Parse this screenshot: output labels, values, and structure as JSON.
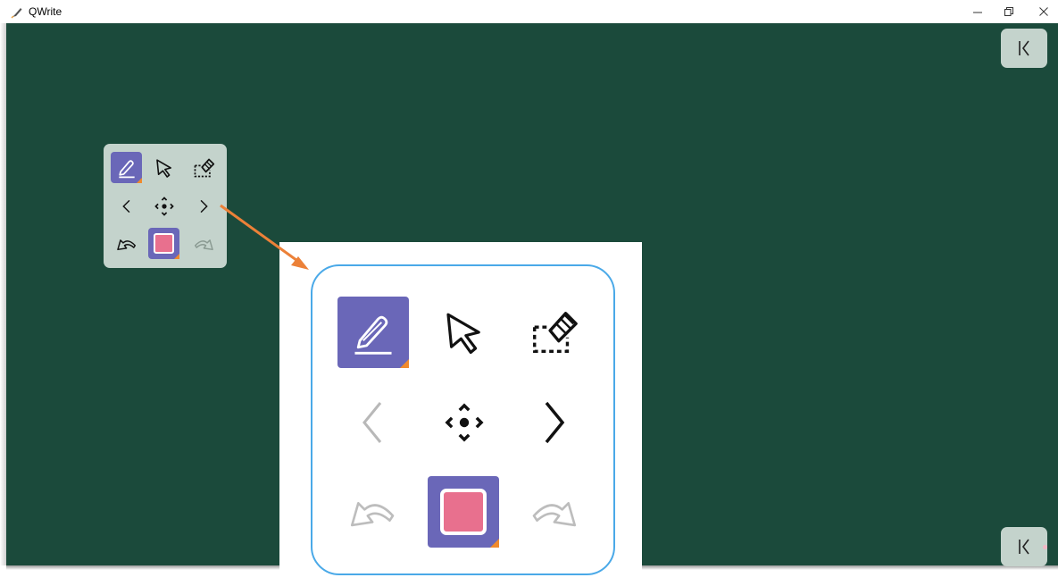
{
  "window": {
    "title": "QWrite",
    "minimize_glyph": "–",
    "restore_glyph": "❐",
    "close_glyph": "✕"
  },
  "colors": {
    "board": "#1b4a3b",
    "toolbar": "#c4d3cc",
    "active_tool": "#6a67b8",
    "pen_color": "#e8708e",
    "corner_accent": "#f08a2c",
    "callout_border": "#4aa9e8",
    "arrow": "#ec8138"
  },
  "toolbar": {
    "tools": [
      {
        "name": "pen-icon",
        "active": true
      },
      {
        "name": "pointer-icon",
        "active": false
      },
      {
        "name": "eraser-selection-icon",
        "active": false
      }
    ],
    "navigation": [
      {
        "name": "previous-page-icon",
        "enabled_small": true,
        "enabled_large": false
      },
      {
        "name": "move-icon",
        "enabled_small": true,
        "enabled_large": true
      },
      {
        "name": "next-page-icon",
        "enabled_small": true,
        "enabled_large": true
      }
    ],
    "history": [
      {
        "name": "undo-icon",
        "enabled_small": true,
        "enabled_large": false
      },
      {
        "name": "color-picker-icon",
        "color": "#e8708e"
      },
      {
        "name": "redo-icon",
        "enabled": false
      }
    ]
  },
  "side_buttons": [
    {
      "name": "collapse-top-icon"
    },
    {
      "name": "collapse-bottom-icon"
    }
  ]
}
